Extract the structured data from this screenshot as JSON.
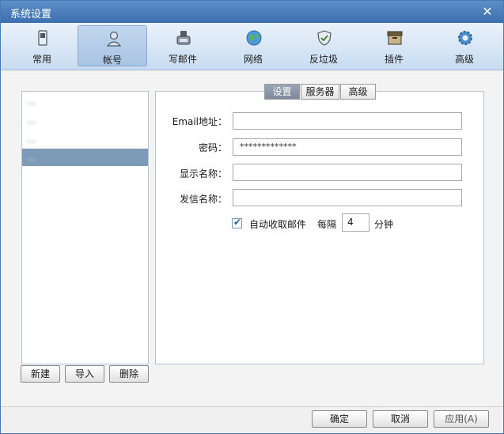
{
  "window": {
    "title": "系统设置"
  },
  "toolbar": {
    "items": [
      {
        "label": "常用",
        "icon": "phone-icon"
      },
      {
        "label": "帐号",
        "icon": "user-icon"
      },
      {
        "label": "写邮件",
        "icon": "compose-icon"
      },
      {
        "label": "网络",
        "icon": "globe-icon"
      },
      {
        "label": "反垃圾",
        "icon": "shield-icon"
      },
      {
        "label": "插件",
        "icon": "plugin-box-icon"
      },
      {
        "label": "高级",
        "icon": "gear-icon"
      }
    ],
    "active_index": 1
  },
  "accounts": {
    "items": [
      {
        "label": "..."
      },
      {
        "label": "..."
      },
      {
        "label": "..."
      },
      {
        "label": "..."
      }
    ],
    "selected_index": 3,
    "buttons": {
      "new": "新建",
      "import": "导入",
      "delete": "删除"
    }
  },
  "tabs": [
    {
      "label": "设置"
    },
    {
      "label": "服务器"
    },
    {
      "label": "高级"
    }
  ],
  "active_tab_index": 0,
  "form": {
    "email_label": "Email地址：",
    "email_value": "",
    "password_label": "密码：",
    "password_value": "*************",
    "display_name_label": "显示名称：",
    "display_name_value": "",
    "sender_name_label": "发信名称：",
    "sender_name_value": "",
    "auto_receive": {
      "label": "自动收取邮件",
      "checked": true
    },
    "interval_prefix": "每隔",
    "interval_value": "4",
    "interval_unit": "分钟"
  },
  "footer": {
    "ok": "确定",
    "cancel": "取消",
    "apply": "应用(A)"
  },
  "colors": {
    "titlebar": "#3b6fae",
    "selection": "#7d9ab9",
    "tab_active": "#7e8a9c"
  }
}
